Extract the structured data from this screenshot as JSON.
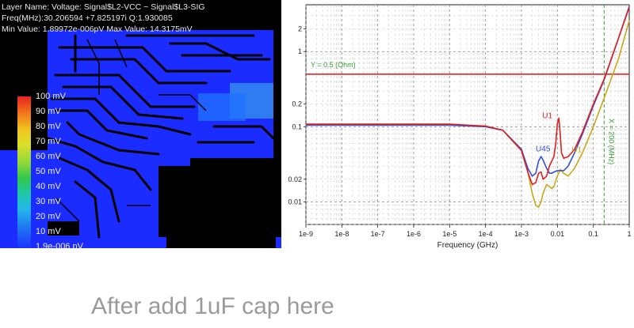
{
  "simulation_panel": {
    "layer_name": "Layer Name: Voltage: Signal$L2-VCC ~ Signal$L3-SIG",
    "freq_line": "Freq(MHz):30.206594    +7.825197i Q:1.930085",
    "min_max_line": "Min Value: 1.89972e-006pV Max Value: 14.3175mV",
    "colorbar_labels": [
      "100 mV",
      "90 mV",
      "80 mV",
      "70 mV",
      "60 mV",
      "50 mV",
      "40 mV",
      "30 mV",
      "20 mV",
      "10 mV",
      "1.9e-006 pV"
    ]
  },
  "chart_data": {
    "type": "line",
    "xscale": "log",
    "yscale": "log",
    "xlabel": "Frequency (GHz)",
    "xlim": [
      1e-09,
      1
    ],
    "ylim": [
      0.005,
      4.2
    ],
    "x_ticks": [
      "1e-9",
      "1e-8",
      "1e-7",
      "1e-6",
      "1e-5",
      "1e-4",
      "1e-3",
      "0.01",
      "0.1",
      "1"
    ],
    "y_ticks": [
      "0.01",
      "0.02",
      "0.1",
      "0.2",
      "1",
      "2"
    ],
    "y_tick_values": [
      0.01,
      0.02,
      0.1,
      0.2,
      1,
      2
    ],
    "grid": true,
    "reference_lines": [
      {
        "axis": "y",
        "value": 0.5,
        "label": "Y = 0.5 (Ohm)",
        "color": "#e01515"
      },
      {
        "axis": "x",
        "value": 0.2,
        "label": "X = 200 (MHz)",
        "color": "#3a9a3a"
      }
    ],
    "series": [
      {
        "name": "U45",
        "color": "#3050e0",
        "x": [
          1e-09,
          1e-05,
          0.0001,
          0.0003,
          0.001,
          0.0015,
          0.002,
          0.0025,
          0.003,
          0.0035,
          0.004,
          0.005,
          0.006,
          0.007,
          0.008,
          0.01,
          0.012,
          0.015,
          0.02,
          0.03,
          0.05,
          0.1,
          0.2,
          0.5,
          1
        ],
        "y": [
          0.105,
          0.105,
          0.1,
          0.09,
          0.05,
          0.028,
          0.022,
          0.024,
          0.035,
          0.04,
          0.036,
          0.028,
          0.024,
          0.024,
          0.025,
          0.026,
          0.026,
          0.026,
          0.03,
          0.045,
          0.08,
          0.19,
          0.42,
          1.5,
          4.0
        ]
      },
      {
        "name": "U1",
        "color": "#e02020",
        "x": [
          1e-09,
          1e-05,
          0.0001,
          0.0003,
          0.001,
          0.0015,
          0.002,
          0.0025,
          0.003,
          0.0035,
          0.004,
          0.005,
          0.006,
          0.007,
          0.008,
          0.009,
          0.01,
          0.011,
          0.012,
          0.013,
          0.015,
          0.02,
          0.03,
          0.05,
          0.1,
          0.2,
          0.5,
          1
        ],
        "y": [
          0.108,
          0.108,
          0.102,
          0.09,
          0.048,
          0.025,
          0.017,
          0.018,
          0.024,
          0.025,
          0.02,
          0.022,
          0.03,
          0.035,
          0.04,
          0.06,
          0.11,
          0.13,
          0.08,
          0.045,
          0.038,
          0.04,
          0.05,
          0.085,
          0.2,
          0.43,
          1.5,
          3.9
        ]
      },
      {
        "name": "U1",
        "color": "#c8a81a",
        "x": [
          1e-09,
          1e-05,
          0.0001,
          0.0003,
          0.001,
          0.0015,
          0.002,
          0.0025,
          0.003,
          0.0035,
          0.004,
          0.005,
          0.006,
          0.007,
          0.008,
          0.01,
          0.012,
          0.015,
          0.02,
          0.03,
          0.05,
          0.1,
          0.2,
          0.5,
          1
        ],
        "y": [
          0.105,
          0.105,
          0.1,
          0.09,
          0.05,
          0.025,
          0.013,
          0.009,
          0.0085,
          0.01,
          0.013,
          0.017,
          0.016,
          0.015,
          0.016,
          0.022,
          0.027,
          0.024,
          0.022,
          0.028,
          0.045,
          0.1,
          0.24,
          0.8,
          2.6
        ]
      }
    ]
  },
  "caption": "After add 1uF cap here"
}
